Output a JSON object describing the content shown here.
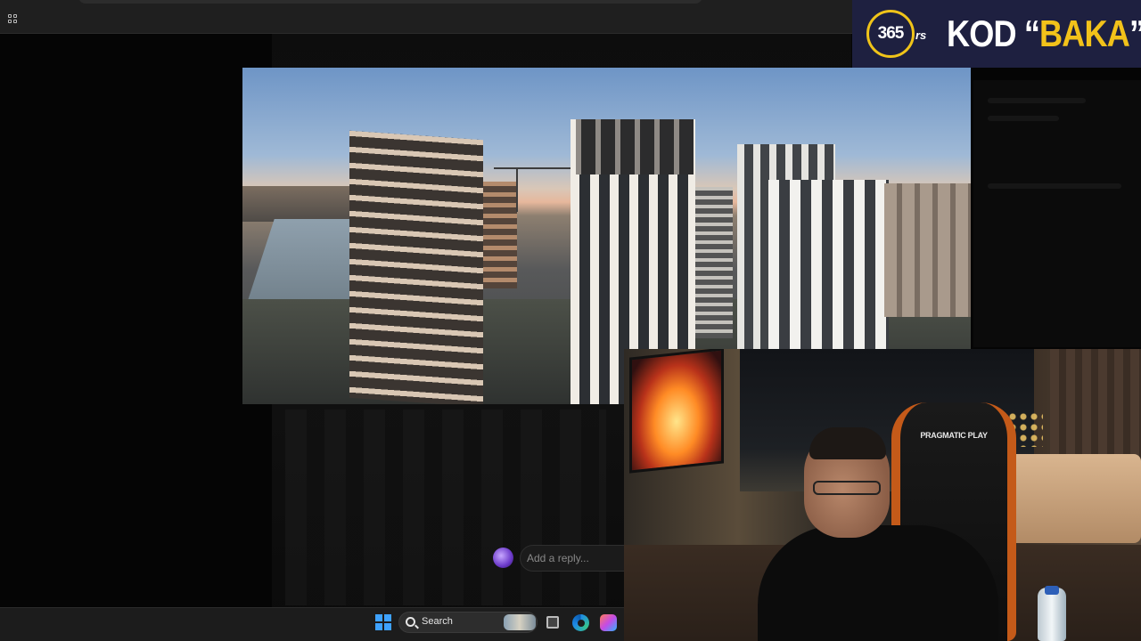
{
  "overlay": {
    "brand_number": "365",
    "brand_suffix": "rs",
    "code_prefix": "KOD “",
    "code_word": "BAKA",
    "code_suffix": "”",
    "accent_color": "#f2c21a",
    "background_color": "#1e2040"
  },
  "comments": {
    "reply_placeholder": "Add a reply..."
  },
  "taskbar": {
    "search_label": "Search",
    "icons": [
      "windows-start-icon",
      "search-icon",
      "task-view-icon",
      "edge-icon",
      "copilot-icon"
    ]
  },
  "webcam": {
    "chair_brand": "PRAGMATIC PLAY"
  }
}
